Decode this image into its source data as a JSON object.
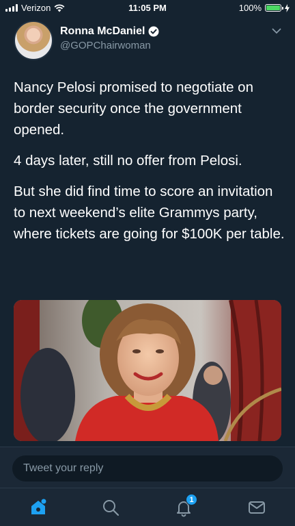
{
  "status_bar": {
    "carrier": "Verizon",
    "time": "11:05 PM",
    "battery": "100%",
    "battery_level": 1.0
  },
  "tweet": {
    "display_name": "Ronna McDaniel",
    "handle": "@GOPChairwoman",
    "paragraphs": [
      "Nancy Pelosi promised to negotiate on border security once the government opened.",
      "4 days later, still no offer from Pelosi.",
      "But she did find time to score an invitation to next weekend’s elite Grammys party, where tickets are going for $100K per table."
    ]
  },
  "reply": {
    "placeholder": "Tweet your reply"
  },
  "tab_bar": {
    "items": [
      "home-icon",
      "search-icon",
      "notifications-icon",
      "messages-icon"
    ],
    "notifications_badge": "1"
  },
  "colors": {
    "background": "#152330",
    "accent": "#1da1f2",
    "secondary_text": "#8899a6",
    "battery_green": "#4cd964"
  }
}
